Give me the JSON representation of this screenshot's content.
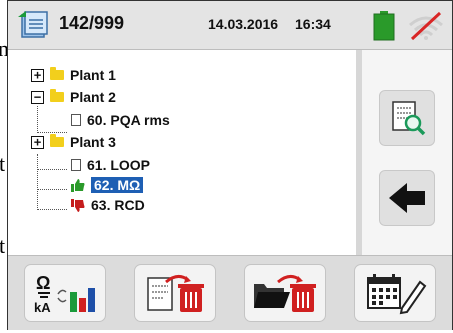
{
  "statusbar": {
    "record_count": "142/999",
    "date": "14.03.2016",
    "time": "16:34",
    "battery_color": "#2a9a2a",
    "wifi_slash_color": "#d92626"
  },
  "tree": {
    "nodes": [
      {
        "label": "Plant 1",
        "expander": "+"
      },
      {
        "label": "Plant 2",
        "expander": "−"
      },
      {
        "label": "60. PQA rms"
      },
      {
        "label": "Plant 3",
        "expander": "+"
      },
      {
        "label": "61. LOOP"
      },
      {
        "label": "62. MΩ",
        "selected": true,
        "status": "pass"
      },
      {
        "label": "63. RCD",
        "status": "fail"
      }
    ]
  },
  "side_buttons": [
    "view-measure-icon",
    "back-arrow-icon"
  ],
  "bottom_buttons": {
    "icons": [
      "measure-function-icon",
      "delete-measure-icon",
      "delete-folder-icon",
      "calendar-edit-icon"
    ],
    "function_symbols": [
      "Ω",
      "kA"
    ]
  },
  "colors": {
    "selection": "#1e5fb4",
    "folder": "#f2cf1c",
    "thumb_up": "#2a9a2a",
    "thumb_down": "#c51c1c",
    "delete_red": "#d02020"
  },
  "bleed_text": {
    "a": "n",
    "b": "t",
    "c": "t"
  }
}
